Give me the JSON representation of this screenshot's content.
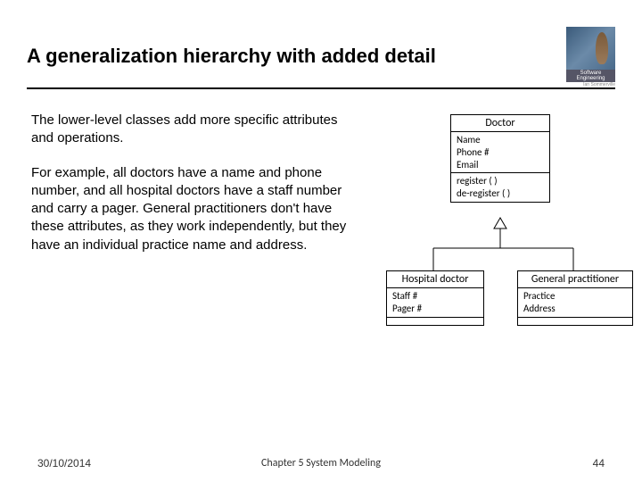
{
  "title": "A generalization hierarchy with added detail",
  "logo": {
    "caption": "Software Engineering",
    "sub": "Ian Sommerville"
  },
  "body": {
    "p1": "The lower-level classes add more specific attributes and operations.",
    "p2": "For example, all doctors have a name and phone number, and all hospital doctors have a staff number and carry a pager. General practitioners don't have these attributes, as they work independently, but they have an individual practice name and address."
  },
  "uml": {
    "doctor": {
      "title": "Doctor",
      "attrs": [
        "Name",
        "Phone #",
        "Email"
      ],
      "ops": [
        "register ( )",
        "de-register ( )"
      ]
    },
    "hospital": {
      "title": "Hospital doctor",
      "attrs": [
        "Staff #",
        "Pager #"
      ],
      "ops": []
    },
    "gp": {
      "title": "General practitioner",
      "attrs": [
        "Practice",
        "Address"
      ],
      "ops": []
    }
  },
  "footer": {
    "date": "30/10/2014",
    "chapter": "Chapter 5 System Modeling",
    "page": "44"
  }
}
